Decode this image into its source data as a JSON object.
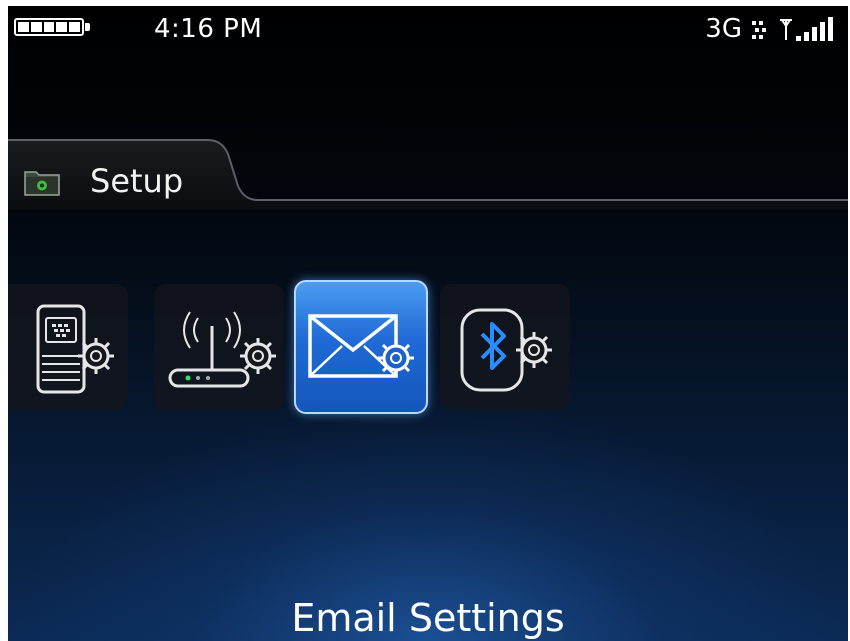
{
  "status_bar": {
    "battery_icon": "battery-full-icon",
    "time": "4:16 PM",
    "network_type": "3G",
    "data_icon": "data-transfer-icon",
    "signal_icon": "signal-strength-icon"
  },
  "header": {
    "folder_icon": "folder-icon",
    "title": "Setup"
  },
  "icons": [
    {
      "name": "device-setup-icon",
      "selected": false
    },
    {
      "name": "wifi-setup-icon",
      "selected": false
    },
    {
      "name": "email-settings-icon",
      "selected": true
    },
    {
      "name": "bluetooth-setup-icon",
      "selected": false
    }
  ],
  "selected_label": "Email Settings",
  "colors": {
    "selection_blue": "#1f6ad6",
    "bluetooth_blue": "#2a8cff",
    "wifi_led_green": "#36e05a",
    "folder_green": "#3fbf3f"
  }
}
